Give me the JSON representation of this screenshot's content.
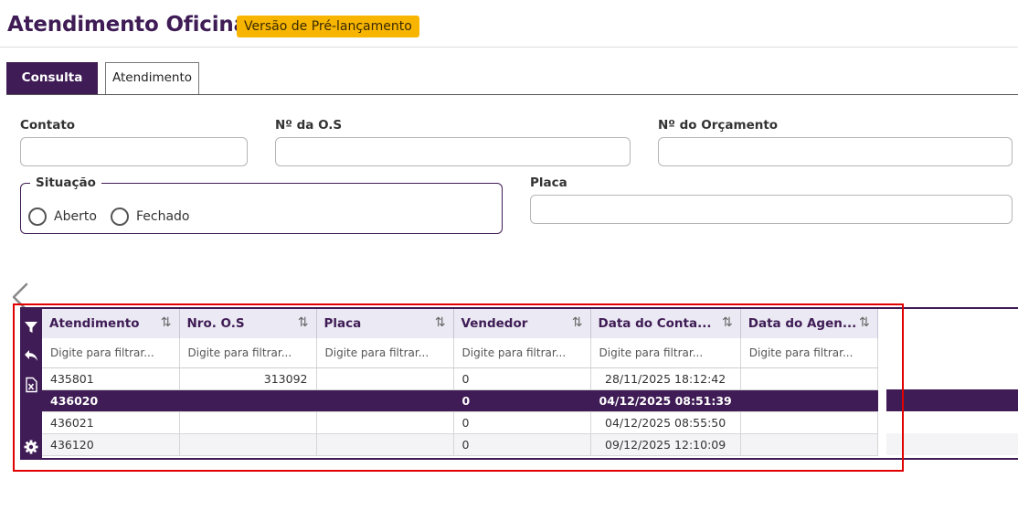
{
  "header": {
    "title": "Atendimento Oficina",
    "badge": "Versão de Pré-lançamento"
  },
  "tabs": [
    {
      "label": "Consulta",
      "active": true
    },
    {
      "label": "Atendimento",
      "active": false
    }
  ],
  "form": {
    "contato": {
      "label": "Contato",
      "value": ""
    },
    "nro_os": {
      "label": "Nº da O.S",
      "value": ""
    },
    "nro_orcamento": {
      "label": "Nº do Orçamento",
      "value": ""
    },
    "situacao": {
      "legend": "Situação",
      "options": [
        "Aberto",
        "Fechado"
      ],
      "selected": null
    },
    "placa": {
      "label": "Placa",
      "value": ""
    }
  },
  "grid": {
    "toolbar_icons": [
      "filter-icon",
      "undo-icon",
      "excel-export-icon",
      "settings-icon"
    ],
    "columns": [
      {
        "label": "Atendimento",
        "filter_placeholder": "Digite para filtrar..."
      },
      {
        "label": "Nro. O.S",
        "filter_placeholder": "Digite para filtrar..."
      },
      {
        "label": "Placa",
        "filter_placeholder": "Digite para filtrar..."
      },
      {
        "label": "Vendedor",
        "filter_placeholder": "Digite para filtrar..."
      },
      {
        "label": "Data do Conta...",
        "filter_placeholder": "Digite para filtrar..."
      },
      {
        "label": "Data do Agen...",
        "filter_placeholder": "Digite para filtrar..."
      }
    ],
    "sort_glyph": "⇅",
    "rows": [
      {
        "atendimento": "435801",
        "nro_os": "313092",
        "placa": "",
        "vendedor": "0",
        "data_contato": "28/11/2025 18:12:42",
        "data_agendamento": "",
        "selected": false
      },
      {
        "atendimento": "436020",
        "nro_os": "",
        "placa": "",
        "vendedor": "0",
        "data_contato": "04/12/2025 08:51:39",
        "data_agendamento": "",
        "selected": true
      },
      {
        "atendimento": "436021",
        "nro_os": "",
        "placa": "",
        "vendedor": "0",
        "data_contato": "04/12/2025 08:55:50",
        "data_agendamento": "",
        "selected": false
      },
      {
        "atendimento": "436120",
        "nro_os": "",
        "placa": "",
        "vendedor": "0",
        "data_contato": "09/12/2025 12:10:09",
        "data_agendamento": "",
        "selected": false
      }
    ]
  },
  "colors": {
    "primary": "#3f1c55",
    "badge": "#f7b500",
    "highlight": "#e00000"
  }
}
